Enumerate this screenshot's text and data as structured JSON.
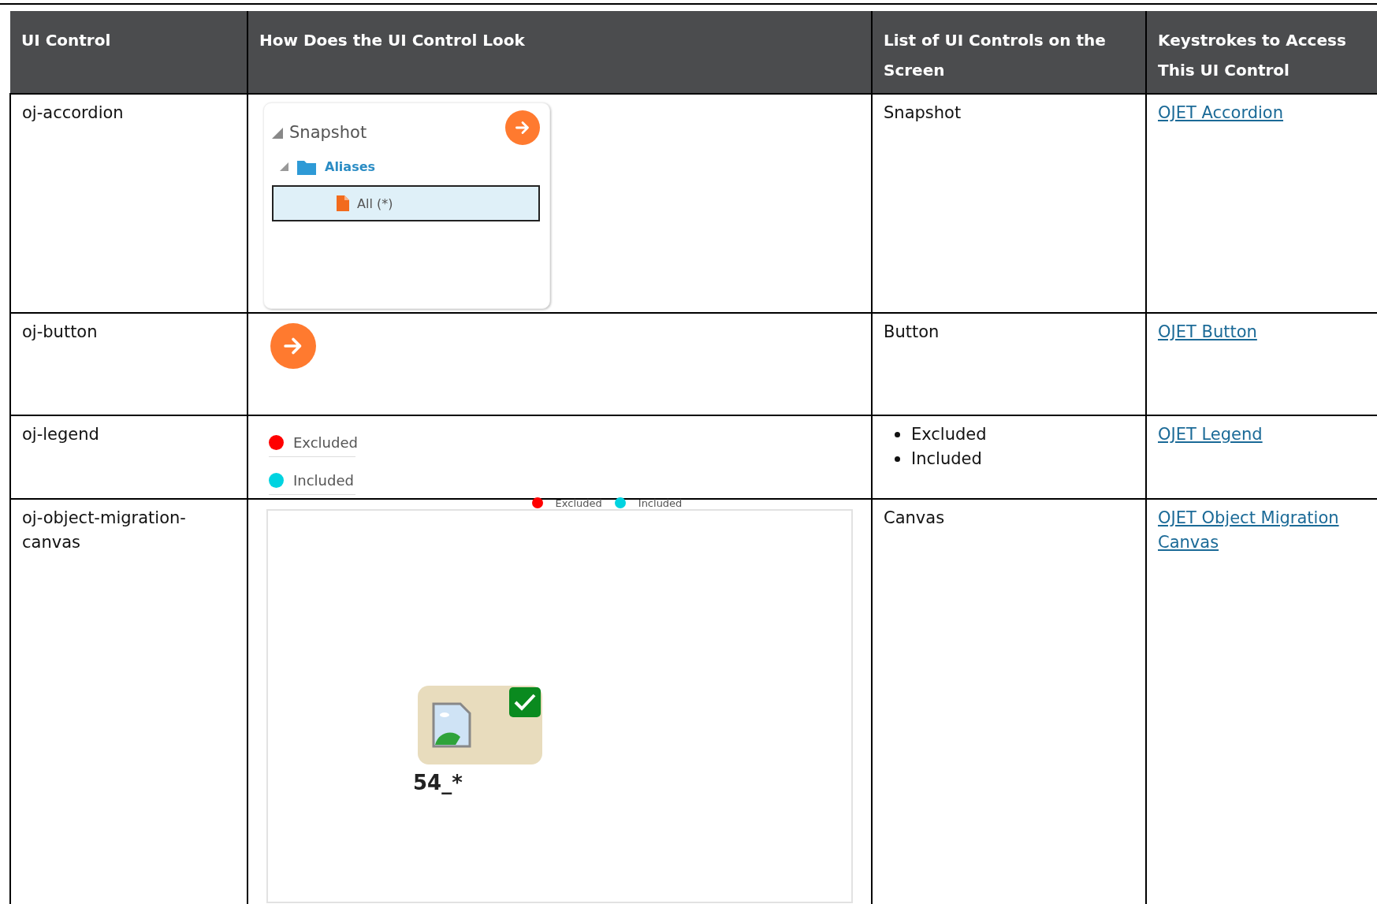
{
  "table": {
    "columns": [
      "UI Control",
      "How Does the UI Control Look",
      "List of UI Controls on the Screen",
      "Keystrokes to Access This UI Control"
    ],
    "rows": [
      {
        "control": "oj-accordion",
        "look": {
          "kind": "accordion",
          "title": "Snapshot",
          "folder": "Aliases",
          "item": "All (*)",
          "item_selected": true
        },
        "screen_controls": {
          "kind": "text",
          "items": [
            "Snapshot"
          ]
        },
        "link": "OJET Accordion"
      },
      {
        "control": "oj-button",
        "look": {
          "kind": "button"
        },
        "screen_controls": {
          "kind": "text",
          "items": [
            "Button"
          ]
        },
        "link": "OJET Button"
      },
      {
        "control": "oj-legend",
        "look": {
          "kind": "legend",
          "items": [
            {
              "label": "Excluded",
              "color": "#ff0000"
            },
            {
              "label": "Included",
              "color": "#00d3e0"
            }
          ]
        },
        "screen_controls": {
          "kind": "bullets",
          "items": [
            "Excluded",
            "Included"
          ]
        },
        "link": "OJET Legend"
      },
      {
        "control": "oj-object-migration-canvas",
        "look": {
          "kind": "canvas",
          "legend": [
            {
              "label": "Excluded",
              "color": "#ff0000"
            },
            {
              "label": "Included",
              "color": "#00d3e0"
            }
          ],
          "node": {
            "label": "54_*",
            "checked": true
          }
        },
        "screen_controls": {
          "kind": "text",
          "items": [
            "Canvas"
          ]
        },
        "link": "OJET Object Migration Canvas"
      }
    ]
  }
}
